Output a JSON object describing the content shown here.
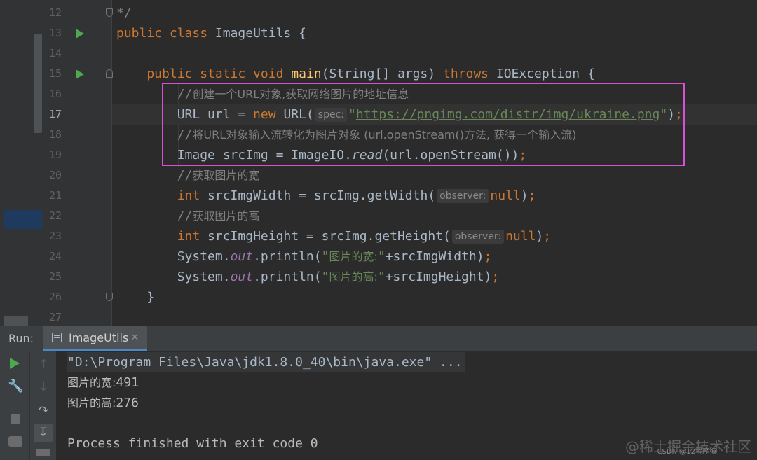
{
  "editor": {
    "lines": [
      {
        "num": "12",
        "segments": [
          {
            "t": "*/",
            "c": "cm"
          }
        ]
      },
      {
        "num": "13",
        "segments": [
          {
            "t": "public class ",
            "c": "kw"
          },
          {
            "t": "ImageUtils {",
            "c": ""
          }
        ]
      },
      {
        "num": "14",
        "segments": []
      },
      {
        "num": "15",
        "segments": [
          {
            "t": "    public static void ",
            "c": "kw"
          },
          {
            "t": "main",
            "c": "fn"
          },
          {
            "t": "(String[] args) ",
            "c": ""
          },
          {
            "t": "throws ",
            "c": "kw"
          },
          {
            "t": "IOException {",
            "c": ""
          }
        ]
      },
      {
        "num": "16",
        "segments": [
          {
            "t": "        //",
            "c": "cm"
          },
          {
            "t": "创建一个URL对象,获取网络图片的地址信息",
            "c": "cmcn"
          }
        ]
      },
      {
        "num": "17",
        "segments": [
          {
            "t": "        URL url = ",
            "c": ""
          },
          {
            "t": "new ",
            "c": "kw"
          },
          {
            "t": "URL(",
            "c": ""
          },
          {
            "hint": "spec:"
          },
          {
            "t": "\"",
            "c": "str"
          },
          {
            "t": "https://pngimg.com/distr/img/ukraine.png",
            "c": "url"
          },
          {
            "t": "\"",
            "c": "str"
          },
          {
            "t": ")",
            "c": ""
          },
          {
            "t": ";",
            "c": "kw"
          }
        ]
      },
      {
        "num": "18",
        "segments": [
          {
            "t": "        //",
            "c": "cm"
          },
          {
            "t": "将URL对象输入流转化为图片对象 (url.openStream()方法, 获得一个输入流)",
            "c": "cmcn"
          }
        ]
      },
      {
        "num": "19",
        "segments": [
          {
            "t": "        Image srcImg = ImageIO.",
            "c": ""
          },
          {
            "t": "read",
            "c": "italic"
          },
          {
            "t": "(url.openStream())",
            "c": ""
          },
          {
            "t": ";",
            "c": "kw"
          }
        ]
      },
      {
        "num": "20",
        "segments": [
          {
            "t": "        //",
            "c": "cm"
          },
          {
            "t": "获取图片的宽",
            "c": "cmcn"
          }
        ]
      },
      {
        "num": "21",
        "segments": [
          {
            "t": "        int ",
            "c": "kw"
          },
          {
            "t": "srcImgWidth = srcImg.getWidth(",
            "c": ""
          },
          {
            "hint": "observer:"
          },
          {
            "t": "null",
            "c": "kw"
          },
          {
            "t": ")",
            "c": ""
          },
          {
            "t": ";",
            "c": "kw"
          }
        ]
      },
      {
        "num": "22",
        "segments": [
          {
            "t": "        //",
            "c": "cm"
          },
          {
            "t": "获取图片的高",
            "c": "cmcn"
          }
        ]
      },
      {
        "num": "23",
        "segments": [
          {
            "t": "        int ",
            "c": "kw"
          },
          {
            "t": "srcImgHeight = srcImg.getHeight(",
            "c": ""
          },
          {
            "hint": "observer:"
          },
          {
            "t": "null",
            "c": "kw"
          },
          {
            "t": ")",
            "c": ""
          },
          {
            "t": ";",
            "c": "kw"
          }
        ]
      },
      {
        "num": "24",
        "segments": [
          {
            "t": "        System.",
            "c": ""
          },
          {
            "t": "out",
            "c": "static"
          },
          {
            "t": ".println(",
            "c": ""
          },
          {
            "t": "\"",
            "c": "str"
          },
          {
            "t": "图片的宽:",
            "c": "strcn"
          },
          {
            "t": "\"",
            "c": "str"
          },
          {
            "t": "+srcImgWidth)",
            "c": ""
          },
          {
            "t": ";",
            "c": "kw"
          }
        ]
      },
      {
        "num": "25",
        "segments": [
          {
            "t": "        System.",
            "c": ""
          },
          {
            "t": "out",
            "c": "static"
          },
          {
            "t": ".println(",
            "c": ""
          },
          {
            "t": "\"",
            "c": "str"
          },
          {
            "t": "图片的高:",
            "c": "strcn"
          },
          {
            "t": "\"",
            "c": "str"
          },
          {
            "t": "+srcImgHeight)",
            "c": ""
          },
          {
            "t": ";",
            "c": "kw"
          }
        ]
      },
      {
        "num": "26",
        "segments": [
          {
            "t": "    }",
            "c": ""
          }
        ]
      },
      {
        "num": "27",
        "segments": []
      }
    ]
  },
  "run": {
    "label": "Run:",
    "tab_label": "ImageUtils",
    "tab_close": "×"
  },
  "console": {
    "command": "\"D:\\Program Files\\Java\\jdk1.8.0_40\\bin\\java.exe\" ...",
    "width_label": "图片的宽:",
    "width_value": "491",
    "height_label": "图片的高:",
    "height_value": "276",
    "exit_message": "Process finished with exit code 0"
  },
  "watermark": {
    "main": "@稀土掘金技术社区",
    "small": "CSDN @12程序猿"
  }
}
